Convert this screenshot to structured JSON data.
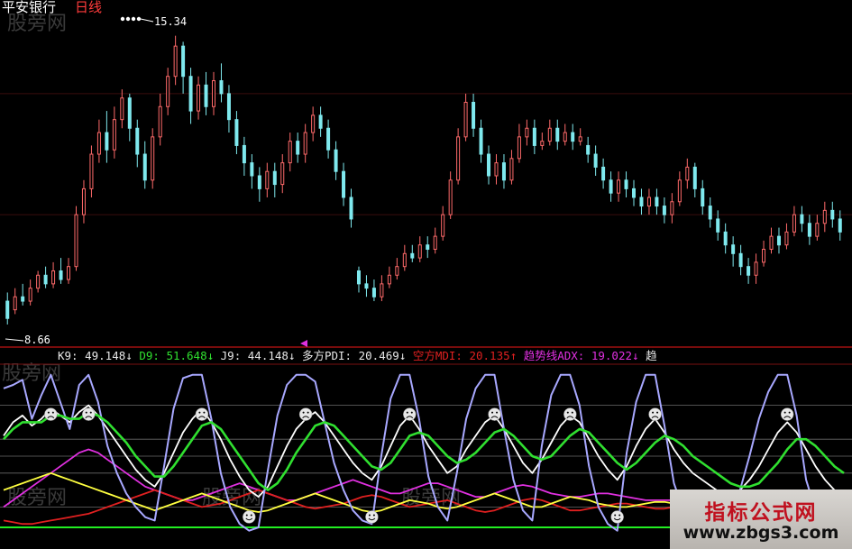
{
  "chart_data": [
    {
      "type": "candlestick",
      "title": "平安银行",
      "subtitle": "日线",
      "ylim": [
        8.2,
        16.0
      ],
      "annotations": {
        "high": "15.34",
        "low": "8.66"
      },
      "candles": [
        [
          9.2,
          8.8,
          9.4,
          8.66
        ],
        [
          9.0,
          9.3,
          9.5,
          8.9
        ],
        [
          9.3,
          9.2,
          9.6,
          9.1
        ],
        [
          9.2,
          9.5,
          9.7,
          9.1
        ],
        [
          9.5,
          9.8,
          9.9,
          9.4
        ],
        [
          9.8,
          9.6,
          10.0,
          9.5
        ],
        [
          9.6,
          9.9,
          10.1,
          9.5
        ],
        [
          9.9,
          9.7,
          10.2,
          9.6
        ],
        [
          9.7,
          10.0,
          10.2,
          9.6
        ],
        [
          10.0,
          11.2,
          11.4,
          9.9
        ],
        [
          11.2,
          11.8,
          12.0,
          11.0
        ],
        [
          11.8,
          12.6,
          12.8,
          11.6
        ],
        [
          12.6,
          13.1,
          13.4,
          12.4
        ],
        [
          13.1,
          12.7,
          13.6,
          12.4
        ],
        [
          12.7,
          13.4,
          13.7,
          12.5
        ],
        [
          13.4,
          13.9,
          14.1,
          13.2
        ],
        [
          13.9,
          13.2,
          14.0,
          12.9
        ],
        [
          13.2,
          12.6,
          13.4,
          12.3
        ],
        [
          12.6,
          12.0,
          12.9,
          11.8
        ],
        [
          12.0,
          13.0,
          13.2,
          11.8
        ],
        [
          13.0,
          13.7,
          14.0,
          12.8
        ],
        [
          13.7,
          14.4,
          14.6,
          13.5
        ],
        [
          14.4,
          15.1,
          15.34,
          14.2
        ],
        [
          15.1,
          14.4,
          15.2,
          14.0
        ],
        [
          14.4,
          13.6,
          14.6,
          13.3
        ],
        [
          13.6,
          14.2,
          14.4,
          13.4
        ],
        [
          14.2,
          13.7,
          14.5,
          13.5
        ],
        [
          13.7,
          14.3,
          14.5,
          13.5
        ],
        [
          14.3,
          14.0,
          14.7,
          13.8
        ],
        [
          14.0,
          13.4,
          14.2,
          13.1
        ],
        [
          13.4,
          12.8,
          13.6,
          12.6
        ],
        [
          12.8,
          12.4,
          13.0,
          12.1
        ],
        [
          12.4,
          12.1,
          12.6,
          11.8
        ],
        [
          12.1,
          11.8,
          12.3,
          11.5
        ],
        [
          11.8,
          12.2,
          12.4,
          11.6
        ],
        [
          12.2,
          11.9,
          12.4,
          11.6
        ],
        [
          11.9,
          12.4,
          12.6,
          11.7
        ],
        [
          12.4,
          12.9,
          13.1,
          12.2
        ],
        [
          12.9,
          12.6,
          13.1,
          12.4
        ],
        [
          12.6,
          13.1,
          13.3,
          12.4
        ],
        [
          13.1,
          13.5,
          13.7,
          12.9
        ],
        [
          13.5,
          13.2,
          13.7,
          13.0
        ],
        [
          13.2,
          12.7,
          13.4,
          12.5
        ],
        [
          12.7,
          12.2,
          12.9,
          12.0
        ],
        [
          12.2,
          11.6,
          12.4,
          11.4
        ],
        [
          11.6,
          11.1,
          11.8,
          10.9
        ],
        [
          9.9,
          9.6,
          10.0,
          9.4
        ],
        [
          9.6,
          9.5,
          9.8,
          9.3
        ],
        [
          9.5,
          9.3,
          9.7,
          9.2
        ],
        [
          9.3,
          9.6,
          9.8,
          9.2
        ],
        [
          9.6,
          9.8,
          10.0,
          9.5
        ],
        [
          9.8,
          10.0,
          10.2,
          9.7
        ],
        [
          10.0,
          10.3,
          10.5,
          9.9
        ],
        [
          10.3,
          10.2,
          10.5,
          10.1
        ],
        [
          10.2,
          10.5,
          10.7,
          10.1
        ],
        [
          10.5,
          10.4,
          10.7,
          10.2
        ],
        [
          10.4,
          10.7,
          10.9,
          10.3
        ],
        [
          10.7,
          11.2,
          11.4,
          10.6
        ],
        [
          11.2,
          12.0,
          12.2,
          11.1
        ],
        [
          12.0,
          13.0,
          13.2,
          11.9
        ],
        [
          13.0,
          13.8,
          14.0,
          12.9
        ],
        [
          13.8,
          13.2,
          14.0,
          13.0
        ],
        [
          13.2,
          12.6,
          13.4,
          12.4
        ],
        [
          12.6,
          12.1,
          12.8,
          11.9
        ],
        [
          12.1,
          12.4,
          12.6,
          11.9
        ],
        [
          12.4,
          12.0,
          12.6,
          11.8
        ],
        [
          12.0,
          12.5,
          12.7,
          11.9
        ],
        [
          12.5,
          13.0,
          13.3,
          12.4
        ],
        [
          13.0,
          13.2,
          13.4,
          12.8
        ],
        [
          13.2,
          12.8,
          13.4,
          12.6
        ],
        [
          12.8,
          12.9,
          13.1,
          12.7
        ],
        [
          12.9,
          13.2,
          13.4,
          12.8
        ],
        [
          13.2,
          12.9,
          13.4,
          12.7
        ],
        [
          12.9,
          13.1,
          13.3,
          12.8
        ],
        [
          13.1,
          12.9,
          13.3,
          12.7
        ],
        [
          12.9,
          13.0,
          13.2,
          12.8
        ],
        [
          12.8,
          12.6,
          13.0,
          12.4
        ],
        [
          12.6,
          12.3,
          12.8,
          12.1
        ],
        [
          12.3,
          12.0,
          12.5,
          11.8
        ],
        [
          12.0,
          11.7,
          12.2,
          11.5
        ],
        [
          11.7,
          12.0,
          12.2,
          11.5
        ],
        [
          12.0,
          11.8,
          12.2,
          11.6
        ],
        [
          11.8,
          11.6,
          12.0,
          11.4
        ],
        [
          11.6,
          11.4,
          11.8,
          11.2
        ],
        [
          11.4,
          11.6,
          11.8,
          11.2
        ],
        [
          11.6,
          11.4,
          11.8,
          11.2
        ],
        [
          11.4,
          11.2,
          11.6,
          11.0
        ],
        [
          11.2,
          11.5,
          11.7,
          11.0
        ],
        [
          11.5,
          12.0,
          12.2,
          11.4
        ],
        [
          12.0,
          12.3,
          12.5,
          11.8
        ],
        [
          12.3,
          11.8,
          12.4,
          11.6
        ],
        [
          11.8,
          11.4,
          12.0,
          11.2
        ],
        [
          11.4,
          11.1,
          11.6,
          10.9
        ],
        [
          11.1,
          10.8,
          11.3,
          10.6
        ],
        [
          10.8,
          10.5,
          11.0,
          10.3
        ],
        [
          10.5,
          10.3,
          10.7,
          10.0
        ],
        [
          10.3,
          10.0,
          10.5,
          9.8
        ],
        [
          10.0,
          9.8,
          10.2,
          9.6
        ],
        [
          9.8,
          10.1,
          10.3,
          9.6
        ],
        [
          10.1,
          10.4,
          10.6,
          10.0
        ],
        [
          10.4,
          10.7,
          10.9,
          10.3
        ],
        [
          10.7,
          10.5,
          10.9,
          10.3
        ],
        [
          10.5,
          10.8,
          11.0,
          10.4
        ],
        [
          10.8,
          11.2,
          11.4,
          10.7
        ],
        [
          11.2,
          11.0,
          11.4,
          10.8
        ],
        [
          11.0,
          10.7,
          11.2,
          10.5
        ],
        [
          10.7,
          11.0,
          11.2,
          10.6
        ],
        [
          11.0,
          11.3,
          11.5,
          10.8
        ],
        [
          11.3,
          11.1,
          11.5,
          10.9
        ],
        [
          11.1,
          10.8,
          11.3,
          10.6
        ]
      ]
    },
    {
      "type": "line",
      "ylim": [
        0,
        100
      ],
      "legend": [
        {
          "label": "K9: ",
          "value": "49.148",
          "arrow": "↓",
          "color": "#e8e8e8"
        },
        {
          "label": "D9: ",
          "value": "51.648",
          "arrow": "↓",
          "color": "#30e030"
        },
        {
          "label": "J9: ",
          "value": "44.148",
          "arrow": "↓",
          "color": "#e8e8e8"
        },
        {
          "label": "多方PDI: ",
          "value": "20.469",
          "arrow": "↓",
          "color": "#e8e8e8"
        },
        {
          "label": "空方MDI: ",
          "value": "20.135",
          "arrow": "↑",
          "color": "#e02020"
        },
        {
          "label": "趋势线ADX: ",
          "value": "19.022",
          "arrow": "↓",
          "color": "#e030e0"
        },
        {
          "label": "趋",
          "value": "",
          "arrow": "",
          "color": "#e8e8e8"
        }
      ],
      "series": [
        {
          "name": "K9",
          "color": "#ffffff",
          "values": [
            62,
            70,
            74,
            68,
            72,
            78,
            74,
            70,
            76,
            80,
            74,
            66,
            58,
            50,
            42,
            36,
            32,
            40,
            52,
            64,
            72,
            78,
            70,
            60,
            48,
            38,
            30,
            26,
            32,
            44,
            56,
            66,
            72,
            76,
            70,
            62,
            54,
            46,
            40,
            36,
            44,
            56,
            68,
            74,
            66,
            56,
            48,
            40,
            44,
            54,
            62,
            70,
            74,
            66,
            56,
            46,
            40,
            48,
            58,
            68,
            74,
            70,
            60,
            50,
            42,
            36,
            44,
            56,
            66,
            72,
            64,
            54,
            46,
            40,
            36,
            32,
            28,
            26,
            30,
            36,
            44,
            54,
            64,
            70,
            64,
            54,
            44,
            36,
            30,
            28
          ]
        },
        {
          "name": "D9",
          "color": "#30e030",
          "values": [
            60,
            66,
            70,
            70,
            70,
            74,
            74,
            72,
            72,
            76,
            74,
            70,
            64,
            58,
            50,
            44,
            38,
            38,
            44,
            52,
            60,
            68,
            70,
            66,
            58,
            50,
            42,
            34,
            30,
            34,
            42,
            52,
            60,
            68,
            70,
            68,
            62,
            56,
            50,
            44,
            42,
            46,
            54,
            62,
            64,
            62,
            56,
            50,
            46,
            48,
            52,
            58,
            64,
            66,
            62,
            56,
            50,
            48,
            50,
            56,
            62,
            66,
            64,
            58,
            52,
            46,
            42,
            46,
            52,
            58,
            62,
            60,
            56,
            50,
            46,
            42,
            38,
            34,
            32,
            32,
            34,
            40,
            46,
            54,
            60,
            60,
            56,
            50,
            44,
            40
          ]
        },
        {
          "name": "J9",
          "color": "#a8a8ff",
          "values": [
            90,
            92,
            95,
            72,
            86,
            98,
            82,
            66,
            92,
            98,
            82,
            56,
            40,
            28,
            20,
            14,
            12,
            44,
            78,
            96,
            98,
            98,
            72,
            40,
            20,
            10,
            6,
            8,
            42,
            74,
            92,
            98,
            98,
            94,
            70,
            46,
            30,
            18,
            12,
            10,
            50,
            84,
            98,
            98,
            72,
            38,
            20,
            12,
            40,
            72,
            90,
            98,
            98,
            66,
            36,
            18,
            12,
            56,
            86,
            98,
            98,
            80,
            44,
            20,
            10,
            6,
            52,
            82,
            98,
            98,
            68,
            34,
            18,
            12,
            10,
            8,
            6,
            6,
            30,
            50,
            72,
            88,
            98,
            98,
            74,
            36,
            18,
            10,
            6,
            6
          ]
        },
        {
          "name": "多方PDI",
          "color": "#ffff40",
          "values": [
            30,
            32,
            34,
            36,
            38,
            40,
            38,
            36,
            34,
            32,
            30,
            28,
            26,
            24,
            22,
            20,
            18,
            20,
            22,
            24,
            26,
            28,
            26,
            24,
            22,
            20,
            18,
            17,
            18,
            20,
            22,
            24,
            26,
            28,
            26,
            24,
            22,
            20,
            18,
            17,
            18,
            20,
            22,
            24,
            23,
            22,
            20,
            19,
            20,
            22,
            24,
            26,
            28,
            26,
            24,
            22,
            20,
            20,
            22,
            24,
            26,
            25,
            24,
            22,
            21,
            20,
            20,
            21,
            22,
            23,
            23,
            22,
            21,
            20,
            19,
            18,
            17,
            17,
            18,
            19,
            20,
            21,
            22,
            23,
            22,
            21,
            20,
            20,
            20,
            20
          ]
        },
        {
          "name": "空方MDI",
          "color": "#e02020",
          "values": [
            12,
            11,
            10,
            10,
            11,
            12,
            13,
            14,
            15,
            16,
            18,
            20,
            22,
            24,
            26,
            28,
            30,
            28,
            26,
            24,
            22,
            20,
            21,
            22,
            24,
            26,
            28,
            30,
            28,
            26,
            24,
            22,
            20,
            19,
            20,
            21,
            22,
            24,
            26,
            27,
            26,
            24,
            22,
            20,
            21,
            22,
            23,
            24,
            22,
            20,
            18,
            17,
            18,
            20,
            22,
            24,
            25,
            24,
            22,
            20,
            18,
            18,
            19,
            20,
            21,
            22,
            22,
            21,
            20,
            19,
            19,
            20,
            21,
            22,
            23,
            24,
            24,
            23,
            22,
            21,
            20,
            19,
            19,
            20,
            20,
            20,
            20,
            20,
            20,
            20
          ]
        },
        {
          "name": "趋势线ADX",
          "color": "#e030e0",
          "values": [
            20,
            24,
            28,
            32,
            36,
            40,
            44,
            48,
            52,
            54,
            52,
            48,
            44,
            40,
            36,
            32,
            30,
            28,
            26,
            24,
            24,
            26,
            28,
            30,
            32,
            34,
            32,
            30,
            28,
            26,
            24,
            24,
            26,
            28,
            30,
            32,
            34,
            36,
            34,
            32,
            30,
            28,
            28,
            30,
            32,
            34,
            34,
            32,
            30,
            28,
            26,
            26,
            28,
            30,
            32,
            33,
            32,
            30,
            28,
            27,
            26,
            26,
            27,
            28,
            28,
            27,
            26,
            25,
            24,
            24,
            24,
            24,
            24,
            23,
            22,
            22,
            22,
            22,
            22,
            21,
            21,
            21,
            20,
            20,
            20,
            20,
            19,
            19,
            19,
            19
          ]
        }
      ]
    }
  ],
  "logo": {
    "name": "指标公式网",
    "url": "www.zbgs3.com"
  },
  "watermark": "股旁网"
}
